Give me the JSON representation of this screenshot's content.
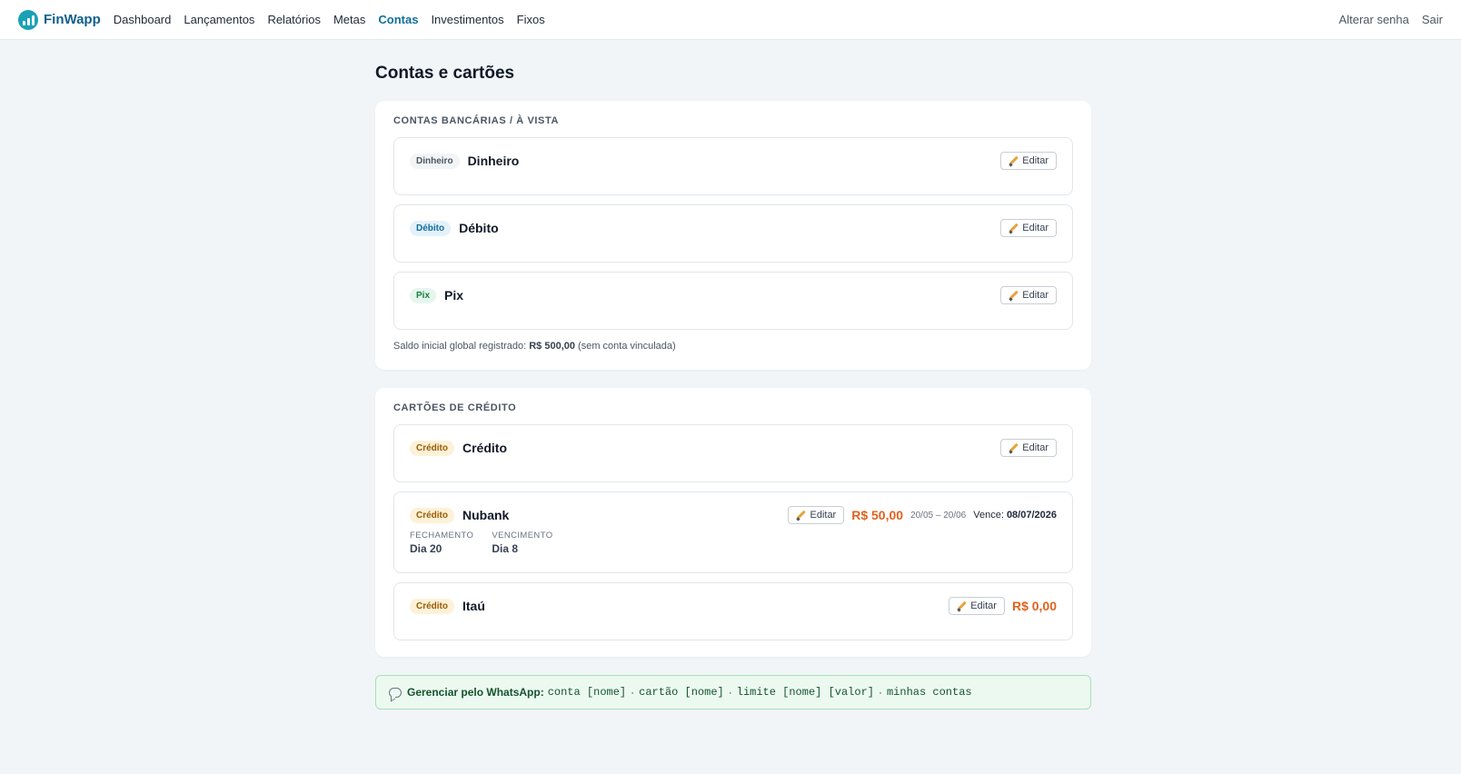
{
  "brand": {
    "name": "FinWapp"
  },
  "nav": {
    "items": [
      "Dashboard",
      "Lançamentos",
      "Relatórios",
      "Metas",
      "Contas",
      "Investimentos",
      "Fixos"
    ],
    "active": "Contas",
    "right": [
      "Alterar senha",
      "Sair"
    ]
  },
  "page": {
    "title": "Contas e cartões"
  },
  "bank": {
    "title": "Contas bancárias / à vista",
    "accounts": [
      {
        "badge": "Dinheiro",
        "name": "Dinheiro",
        "edit": "Editar"
      },
      {
        "badge": "Débito",
        "name": "Débito",
        "edit": "Editar"
      },
      {
        "badge": "Pix",
        "name": "Pix",
        "edit": "Editar"
      }
    ],
    "saldo_prefix": "Saldo inicial global registrado:",
    "saldo_value": "R$ 500,00",
    "saldo_suffix": "(sem conta vinculada)"
  },
  "credit": {
    "title": "Cartões de crédito",
    "cards": [
      {
        "badge": "Crédito",
        "name": "Crédito",
        "edit": "Editar"
      },
      {
        "badge": "Crédito",
        "name": "Nubank",
        "edit": "Editar",
        "amount": "R$ 50,00",
        "period": "20/05 – 20/06",
        "due_label": "Vence:",
        "due_date": "08/07/2026",
        "fechamento_label": "Fechamento",
        "fechamento_value": "Dia 20",
        "vencimento_label": "Vencimento",
        "vencimento_value": "Dia 8"
      },
      {
        "badge": "Crédito",
        "name": "Itaú",
        "edit": "Editar",
        "amount": "R$ 0,00"
      }
    ]
  },
  "whatsapp": {
    "icon": "chat-bubble-icon",
    "label": "Gerenciar pelo WhatsApp:",
    "commands": [
      "conta [nome]",
      "cartão [nome]",
      "limite [nome] [valor]",
      "minhas contas"
    ],
    "separator": "·"
  },
  "colors": {
    "accent": "#0f6e9e",
    "amount": "#e0621e",
    "whatsapp_bg": "#ecf9f0"
  }
}
